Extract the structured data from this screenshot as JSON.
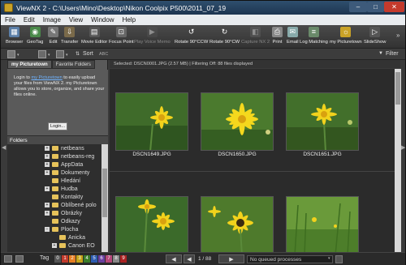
{
  "window": {
    "title": "ViewNX 2 - C:\\Users\\Mino\\Desktop\\Nikon Coolpix P500\\2011_07_19",
    "minimize": "–",
    "maximize": "□",
    "close": "✕"
  },
  "menu": [
    "File",
    "Edit",
    "Image",
    "View",
    "Window",
    "Help"
  ],
  "toolbar": {
    "browser": "Browser",
    "geotag": "GeoTag",
    "edit": "Edit",
    "transfer": "Transfer",
    "movie_editor": "Movie Editor",
    "focus_point": "Focus Point",
    "play_voice_memo": "Play Voice Memo",
    "rotate_ccw": "Rotate 90°CCW",
    "rotate_cw": "Rotate 90°CW",
    "capture": "Capture NX 2",
    "print": "Print",
    "email": "Email",
    "log_matching": "Log Matching",
    "my_picturetown": "my Picturetown",
    "slideshow": "SlideShow"
  },
  "secondrow": {
    "sort": "Sort",
    "sort_value": "ABC",
    "filter": "Filter"
  },
  "leftpanel": {
    "tab_active": "my Picturetown",
    "tab_other": "Favorite Folders",
    "login_prefix": "Login to ",
    "login_link": "my Picturetown",
    "login_rest": " to easily upload your files from ViewNX 2. my Picturetown allows you to store, organize, and share your files online.",
    "login_button": "Login...",
    "folders_header": "Folders",
    "tree": [
      {
        "label": "netbeans",
        "expander": "+",
        "kind": "folder"
      },
      {
        "label": "netbeans-reg",
        "expander": "+",
        "kind": "folder"
      },
      {
        "label": "AppData",
        "expander": "+",
        "kind": "folder"
      },
      {
        "label": "Dokumenty",
        "expander": "+",
        "kind": "folder"
      },
      {
        "label": "Hledání",
        "expander": "",
        "kind": "folder"
      },
      {
        "label": "Hudba",
        "expander": "+",
        "kind": "folder"
      },
      {
        "label": "Kontakty",
        "expander": "",
        "kind": "folder"
      },
      {
        "label": "Oblíbené polo",
        "expander": "+",
        "kind": "folder"
      },
      {
        "label": "Obrázky",
        "expander": "+",
        "kind": "folder"
      },
      {
        "label": "Odkazy",
        "expander": "",
        "kind": "folder"
      },
      {
        "label": "Plocha",
        "expander": "−",
        "kind": "folder"
      },
      {
        "label": "Anicka",
        "expander": "",
        "kind": "folder"
      },
      {
        "label": "Canon EO",
        "expander": "+",
        "kind": "folder"
      }
    ]
  },
  "info": "Selected: DSCN0001.JPG (2.57 MB) | Filtering Off: 88 files displayed",
  "thumbnails": [
    {
      "name": "DSCN1649.JPG"
    },
    {
      "name": "DSCN1650.JPG"
    },
    {
      "name": "DSCN1651.JPG"
    },
    {
      "name": ""
    },
    {
      "name": ""
    },
    {
      "name": ""
    }
  ],
  "status": {
    "tag_label": "Tag",
    "tags": [
      "0",
      "1",
      "2",
      "3",
      "4",
      "5",
      "6",
      "7",
      "8",
      "9"
    ],
    "tag_colors": [
      "#555555",
      "#c0392b",
      "#e67e22",
      "#c5a317",
      "#3a7d2a",
      "#2d5bb0",
      "#6a3fa0",
      "#b5487a",
      "#888888",
      "#aa2222"
    ],
    "page": "1 / 88",
    "queue": "No queued processes",
    "prev": "◀",
    "next": "▶"
  },
  "colors": {
    "accent": "#c9a227",
    "titlebar": "#2f4f6e",
    "link": "#6fb3ff"
  }
}
